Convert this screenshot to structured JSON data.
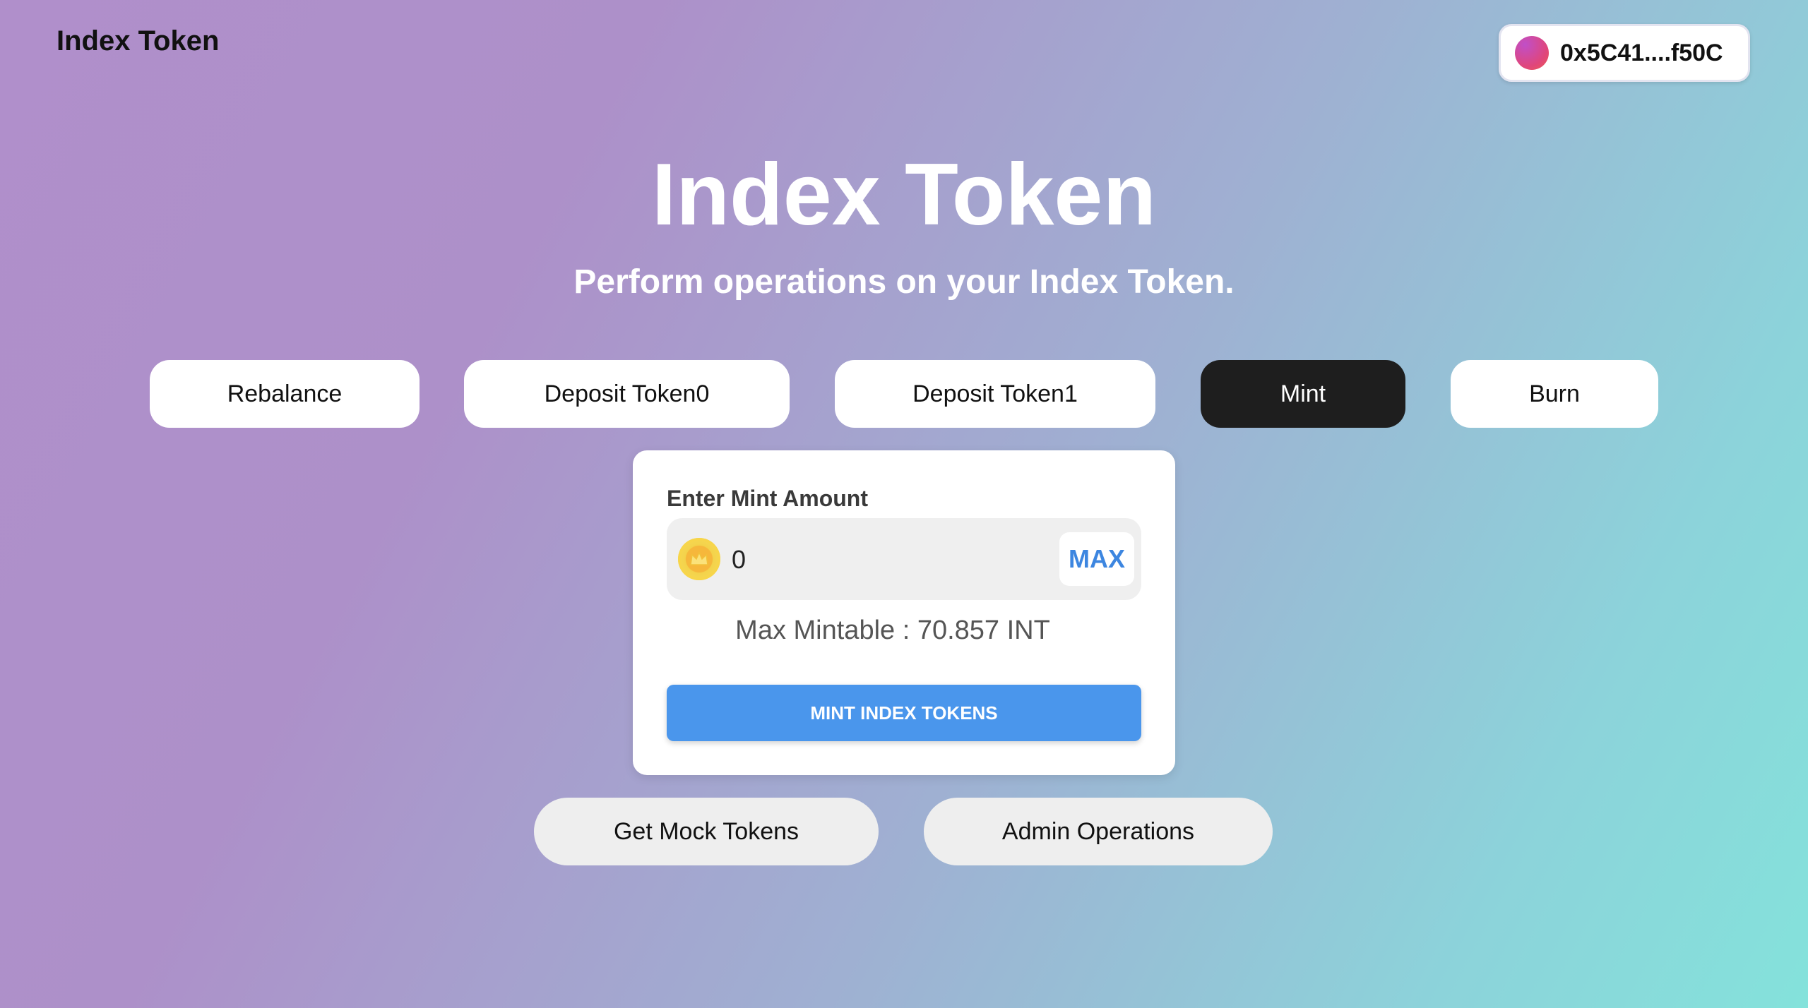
{
  "header": {
    "brand": "Index Token",
    "wallet_address": "0x5C41....f50C"
  },
  "hero": {
    "title": "Index Token",
    "subtitle": "Perform operations on your Index Token."
  },
  "tabs": [
    {
      "label": "Rebalance",
      "active": false
    },
    {
      "label": "Deposit Token0",
      "active": false
    },
    {
      "label": "Deposit Token1",
      "active": false
    },
    {
      "label": "Mint",
      "active": true
    },
    {
      "label": "Burn",
      "active": false
    }
  ],
  "mint_card": {
    "label": "Enter Mint Amount",
    "amount_value": "0",
    "max_label": "MAX",
    "max_mintable_text": "Max Mintable : 70.857 INT",
    "action_label": "MINT INDEX TOKENS"
  },
  "footer_buttons": {
    "mock_tokens": "Get Mock Tokens",
    "admin": "Admin Operations"
  },
  "colors": {
    "accent_blue": "#4a96ec",
    "max_text": "#3d86e0",
    "active_tab": "#1e1e1e",
    "gradient_start": "#b08fcb",
    "gradient_end": "#84e2db"
  },
  "icons": {
    "token": "coin-icon",
    "wallet": "wallet-avatar"
  }
}
